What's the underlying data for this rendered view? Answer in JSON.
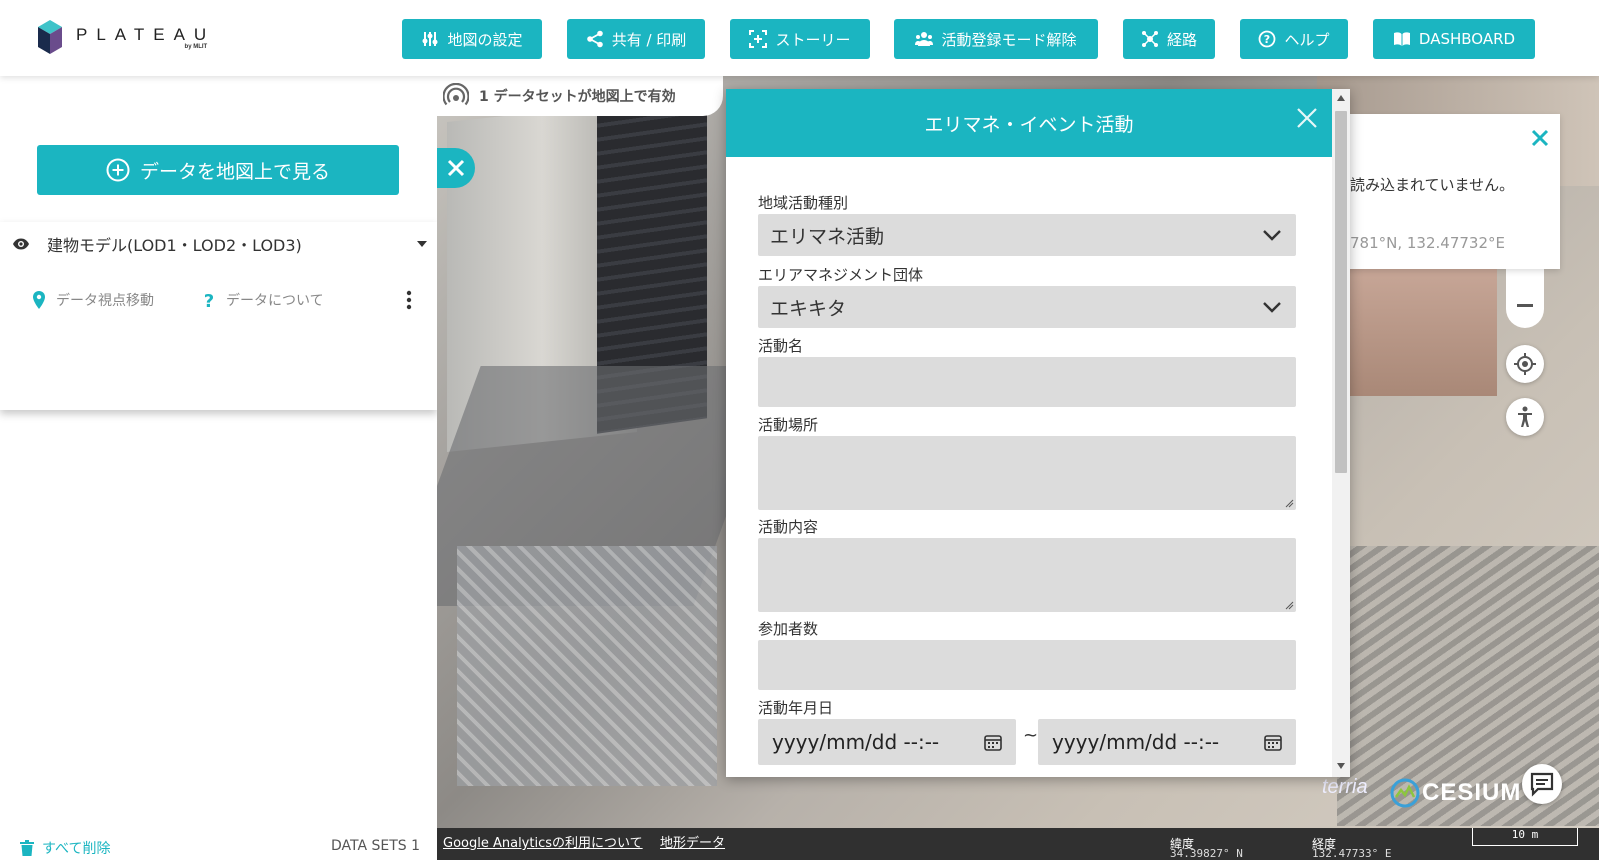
{
  "colors": {
    "accent": "#1bb5c1",
    "bottom_bar": "#303030"
  },
  "logo": {
    "word": "PLATEAU",
    "sub": "by MLIT"
  },
  "nav": {
    "items": [
      {
        "label": "地図の設定",
        "icon": "sliders-icon"
      },
      {
        "label": "共有 / 印刷",
        "icon": "share-icon"
      },
      {
        "label": "ストーリー",
        "icon": "story-icon"
      },
      {
        "label": "活動登録モード解除",
        "icon": "users-icon"
      },
      {
        "label": "経路",
        "icon": "route-icon"
      },
      {
        "label": "ヘルプ",
        "icon": "help-icon"
      },
      {
        "label": "DASHBOARD",
        "icon": "book-icon"
      }
    ]
  },
  "sidebar": {
    "add_data_label": "データを地図上で見る",
    "dataset": {
      "name": "建物モデル(LOD1・LOD2・LOD3)",
      "action_move": "データ視点移動",
      "action_about": "データについて"
    },
    "delete_all": "すべて削除",
    "datasets_count": "DATA SETS 1"
  },
  "map": {
    "status": "1 データセットが地図上で有効",
    "feature_info": {
      "message": "読み込まれていません。",
      "coords": "781°N, 132.47732°E"
    },
    "brand_terria": "terria",
    "brand_cesium": "CESIUM"
  },
  "bottom_bar": {
    "analytics_link": "Google Analyticsの利用について",
    "terrain_link": "地形データ",
    "lat_label": "緯度",
    "lat_value": "34.39827° N",
    "lon_label": "経度",
    "lon_value": "132.47733° E",
    "scale": "10 m"
  },
  "modal": {
    "title": "エリマネ・イベント活動",
    "fields": {
      "activity_type_label": "地域活動種別",
      "activity_type_value": "エリマネ活動",
      "org_label": "エリアマネジメント団体",
      "org_value": "エキキタ",
      "name_label": "活動名",
      "place_label": "活動場所",
      "content_label": "活動内容",
      "participants_label": "参加者数",
      "date_label": "活動年月日",
      "date_start": "yyyy/mm/dd --:--",
      "date_sep": "~",
      "date_end": "yyyy/mm/dd --:--"
    }
  }
}
